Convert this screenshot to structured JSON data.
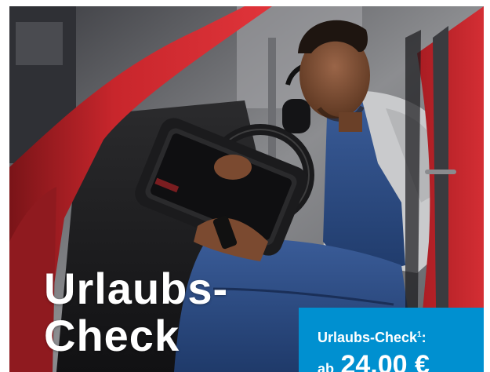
{
  "ad": {
    "headline_line1": "Urlaubs-",
    "headline_line2": "Check",
    "price_box": {
      "label": "Urlaubs-Check",
      "footnote_marker": "1",
      "label_suffix": ":",
      "price_prefix": "ab",
      "price_value": "24,00 €"
    }
  },
  "colors": {
    "car_red": "#c8262c",
    "price_box_blue": "#0090d0",
    "overall_blue": "#2c4f8a",
    "headline_text": "#ffffff"
  },
  "image": {
    "subject": "mechanic-with-diagnostic-tablet-in-car-photo"
  }
}
